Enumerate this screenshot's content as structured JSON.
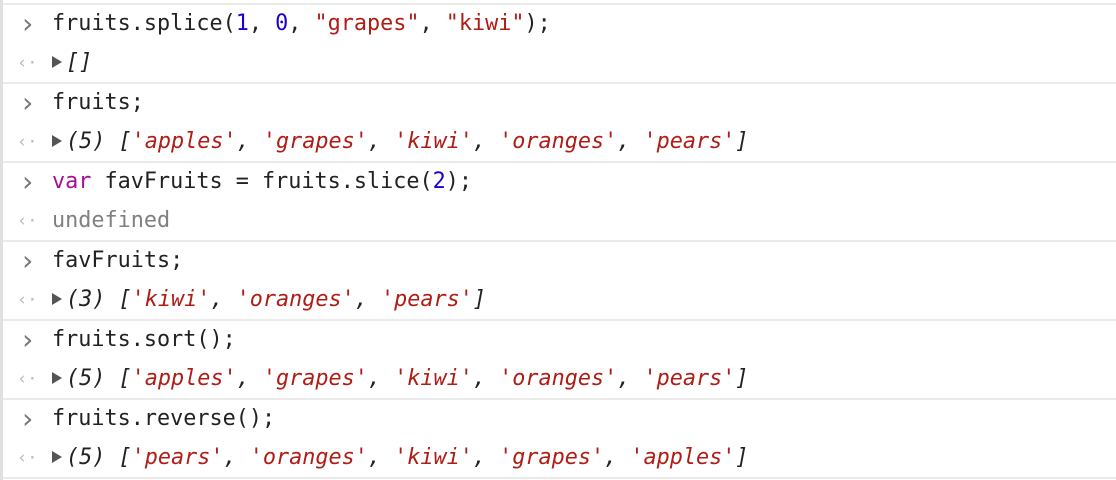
{
  "colors": {
    "number": "#1c00cf",
    "string": "#b01c16",
    "keyword": "#aa0d91",
    "undefined": "#808080"
  },
  "icons": {
    "input_prompt": "chevron-right-icon",
    "result": "return-arrow-icon",
    "expand": "expand-triangle-icon"
  },
  "entries": [
    {
      "input": [
        [
          "t",
          "fruits.splice("
        ],
        [
          "num",
          "1"
        ],
        [
          "t",
          ", "
        ],
        [
          "num",
          "0"
        ],
        [
          "t",
          ", "
        ],
        [
          "str",
          "\"grapes\""
        ],
        [
          "t",
          ", "
        ],
        [
          "str",
          "\"kiwi\""
        ],
        [
          "t",
          ");"
        ]
      ],
      "expandable": true,
      "output": [
        [
          "out",
          "[]"
        ]
      ]
    },
    {
      "input": [
        [
          "t",
          "fruits;"
        ]
      ],
      "expandable": true,
      "output": [
        [
          "out",
          "(5) ["
        ],
        [
          "ostr",
          "'apples'"
        ],
        [
          "out",
          ", "
        ],
        [
          "ostr",
          "'grapes'"
        ],
        [
          "out",
          ", "
        ],
        [
          "ostr",
          "'kiwi'"
        ],
        [
          "out",
          ", "
        ],
        [
          "ostr",
          "'oranges'"
        ],
        [
          "out",
          ", "
        ],
        [
          "ostr",
          "'pears'"
        ],
        [
          "out",
          "]"
        ]
      ]
    },
    {
      "input": [
        [
          "kw",
          "var"
        ],
        [
          "t",
          " favFruits = fruits.slice("
        ],
        [
          "num",
          "2"
        ],
        [
          "t",
          ");"
        ]
      ],
      "expandable": false,
      "output": [
        [
          "undef",
          "undefined"
        ]
      ]
    },
    {
      "input": [
        [
          "t",
          "favFruits;"
        ]
      ],
      "expandable": true,
      "output": [
        [
          "out",
          "(3) ["
        ],
        [
          "ostr",
          "'kiwi'"
        ],
        [
          "out",
          ", "
        ],
        [
          "ostr",
          "'oranges'"
        ],
        [
          "out",
          ", "
        ],
        [
          "ostr",
          "'pears'"
        ],
        [
          "out",
          "]"
        ]
      ]
    },
    {
      "input": [
        [
          "t",
          "fruits.sort();"
        ]
      ],
      "expandable": true,
      "output": [
        [
          "out",
          "(5) ["
        ],
        [
          "ostr",
          "'apples'"
        ],
        [
          "out",
          ", "
        ],
        [
          "ostr",
          "'grapes'"
        ],
        [
          "out",
          ", "
        ],
        [
          "ostr",
          "'kiwi'"
        ],
        [
          "out",
          ", "
        ],
        [
          "ostr",
          "'oranges'"
        ],
        [
          "out",
          ", "
        ],
        [
          "ostr",
          "'pears'"
        ],
        [
          "out",
          "]"
        ]
      ]
    },
    {
      "input": [
        [
          "t",
          "fruits.reverse();"
        ]
      ],
      "expandable": true,
      "output": [
        [
          "out",
          "(5) ["
        ],
        [
          "ostr",
          "'pears'"
        ],
        [
          "out",
          ", "
        ],
        [
          "ostr",
          "'oranges'"
        ],
        [
          "out",
          ", "
        ],
        [
          "ostr",
          "'kiwi'"
        ],
        [
          "out",
          ", "
        ],
        [
          "ostr",
          "'grapes'"
        ],
        [
          "out",
          ", "
        ],
        [
          "ostr",
          "'apples'"
        ],
        [
          "out",
          "]"
        ]
      ]
    }
  ]
}
